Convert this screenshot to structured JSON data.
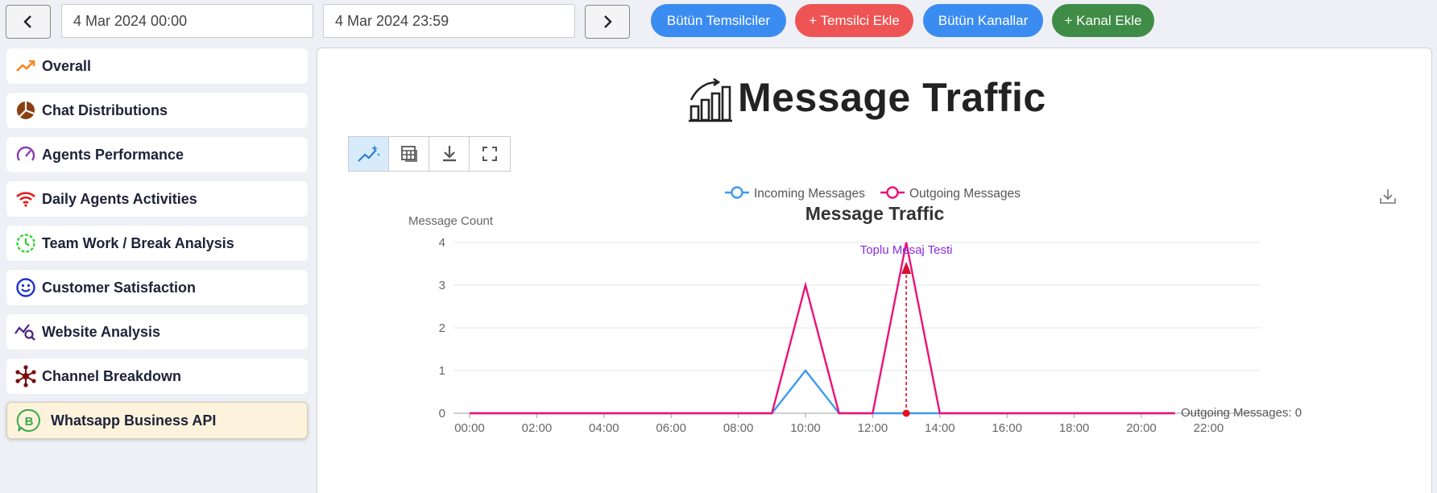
{
  "toolbar": {
    "start_date": "4 Mar 2024 00:00",
    "end_date": "4 Mar 2024 23:59",
    "buttons": [
      {
        "label": "Bütün Temsilciler",
        "color": "#3b8cf0"
      },
      {
        "label": "+ Temsilci Ekle",
        "color": "#ee5454"
      },
      {
        "label": "Bütün Kanallar",
        "color": "#3b8cf0"
      },
      {
        "label": "+ Kanal Ekle",
        "color": "#3f8c46"
      }
    ]
  },
  "sidebar": {
    "items": [
      {
        "label": "Overall",
        "icon": "trend-up-icon"
      },
      {
        "label": "Chat Distributions",
        "icon": "pie-chart-icon"
      },
      {
        "label": "Agents Performance",
        "icon": "gauge-icon"
      },
      {
        "label": "Daily Agents Activities",
        "icon": "wifi-icon"
      },
      {
        "label": "Team Work / Break Analysis",
        "icon": "clock-icon"
      },
      {
        "label": "Customer Satisfaction",
        "icon": "smiley-icon"
      },
      {
        "label": "Website Analysis",
        "icon": "analytics-search-icon"
      },
      {
        "label": "Channel Breakdown",
        "icon": "network-icon"
      },
      {
        "label": "Whatsapp Business API",
        "icon": "whatsapp-business-icon",
        "active": true
      }
    ]
  },
  "main": {
    "title": "Message Traffic",
    "chart_tools": [
      "magic-chart-icon",
      "table-icon",
      "download-icon",
      "fullscreen-icon"
    ]
  },
  "chart_data": {
    "type": "line",
    "title": "Message Traffic",
    "ylabel": "Message Count",
    "xlabel": "",
    "categories": [
      "00:00",
      "01:00",
      "02:00",
      "03:00",
      "04:00",
      "05:00",
      "06:00",
      "07:00",
      "08:00",
      "09:00",
      "10:00",
      "11:00",
      "12:00",
      "13:00",
      "14:00",
      "15:00",
      "16:00",
      "17:00",
      "18:00",
      "19:00",
      "20:00",
      "21:00"
    ],
    "xticks": [
      "00:00",
      "02:00",
      "04:00",
      "06:00",
      "08:00",
      "10:00",
      "12:00",
      "14:00",
      "16:00",
      "18:00",
      "20:00",
      "22:00"
    ],
    "ylim": [
      0,
      4
    ],
    "yticks": [
      0,
      1,
      2,
      3,
      4
    ],
    "legend_position": "top-center",
    "series": [
      {
        "name": "Incoming Messages",
        "color": "#3d9bef",
        "values": [
          0,
          0,
          0,
          0,
          0,
          0,
          0,
          0,
          0,
          0,
          1,
          0,
          0,
          0,
          0,
          0,
          0,
          0,
          0,
          0,
          0,
          0
        ]
      },
      {
        "name": "Outgoing Messages",
        "color": "#ee1177",
        "values": [
          0,
          0,
          0,
          0,
          0,
          0,
          0,
          0,
          0,
          0,
          3,
          0,
          0,
          4,
          0,
          0,
          0,
          0,
          0,
          0,
          0,
          0
        ]
      }
    ],
    "annotations": {
      "peak_label": "Toplu Mesaj Testi",
      "end_label": "Outgoing Messages: 0"
    }
  }
}
